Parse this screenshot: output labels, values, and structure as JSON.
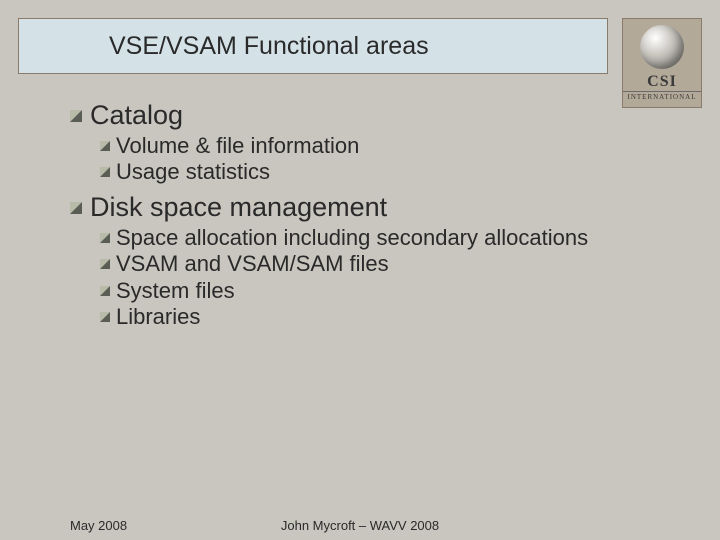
{
  "title": "VSE/VSAM Functional areas",
  "logo": {
    "line1": "CSI",
    "line2": "INTERNATIONAL"
  },
  "sections": [
    {
      "heading": "Catalog",
      "items": [
        "Volume & file information",
        "Usage statistics"
      ]
    },
    {
      "heading": "Disk space management",
      "items": [
        "Space allocation including secondary allocations",
        "VSAM and VSAM/SAM files",
        "System files",
        "Libraries"
      ]
    }
  ],
  "footer": {
    "date": "May 2008",
    "author": "John Mycroft – WAVV 2008"
  }
}
